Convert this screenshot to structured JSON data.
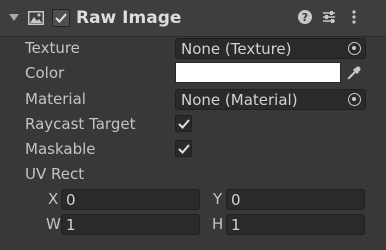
{
  "header": {
    "title": "Raw Image",
    "enabled": true,
    "icons": [
      "foldout-arrow-icon",
      "raw-image-icon",
      "help-icon",
      "presets-icon",
      "kebab-menu-icon"
    ]
  },
  "properties": {
    "texture": {
      "label": "Texture",
      "value": "None (Texture)"
    },
    "color": {
      "label": "Color",
      "value": "#FFFFFF"
    },
    "material": {
      "label": "Material",
      "value": "None (Material)"
    },
    "raycast_target": {
      "label": "Raycast Target",
      "checked": true
    },
    "maskable": {
      "label": "Maskable",
      "checked": true
    },
    "uv_rect": {
      "label": "UV Rect",
      "x_label": "X",
      "x": "0",
      "y_label": "Y",
      "y": "0",
      "w_label": "W",
      "w": "1",
      "h_label": "H",
      "h": "1"
    }
  },
  "colors": {
    "background": "#383838",
    "field": "#2a2a2a",
    "text": "#c4c4c4"
  }
}
